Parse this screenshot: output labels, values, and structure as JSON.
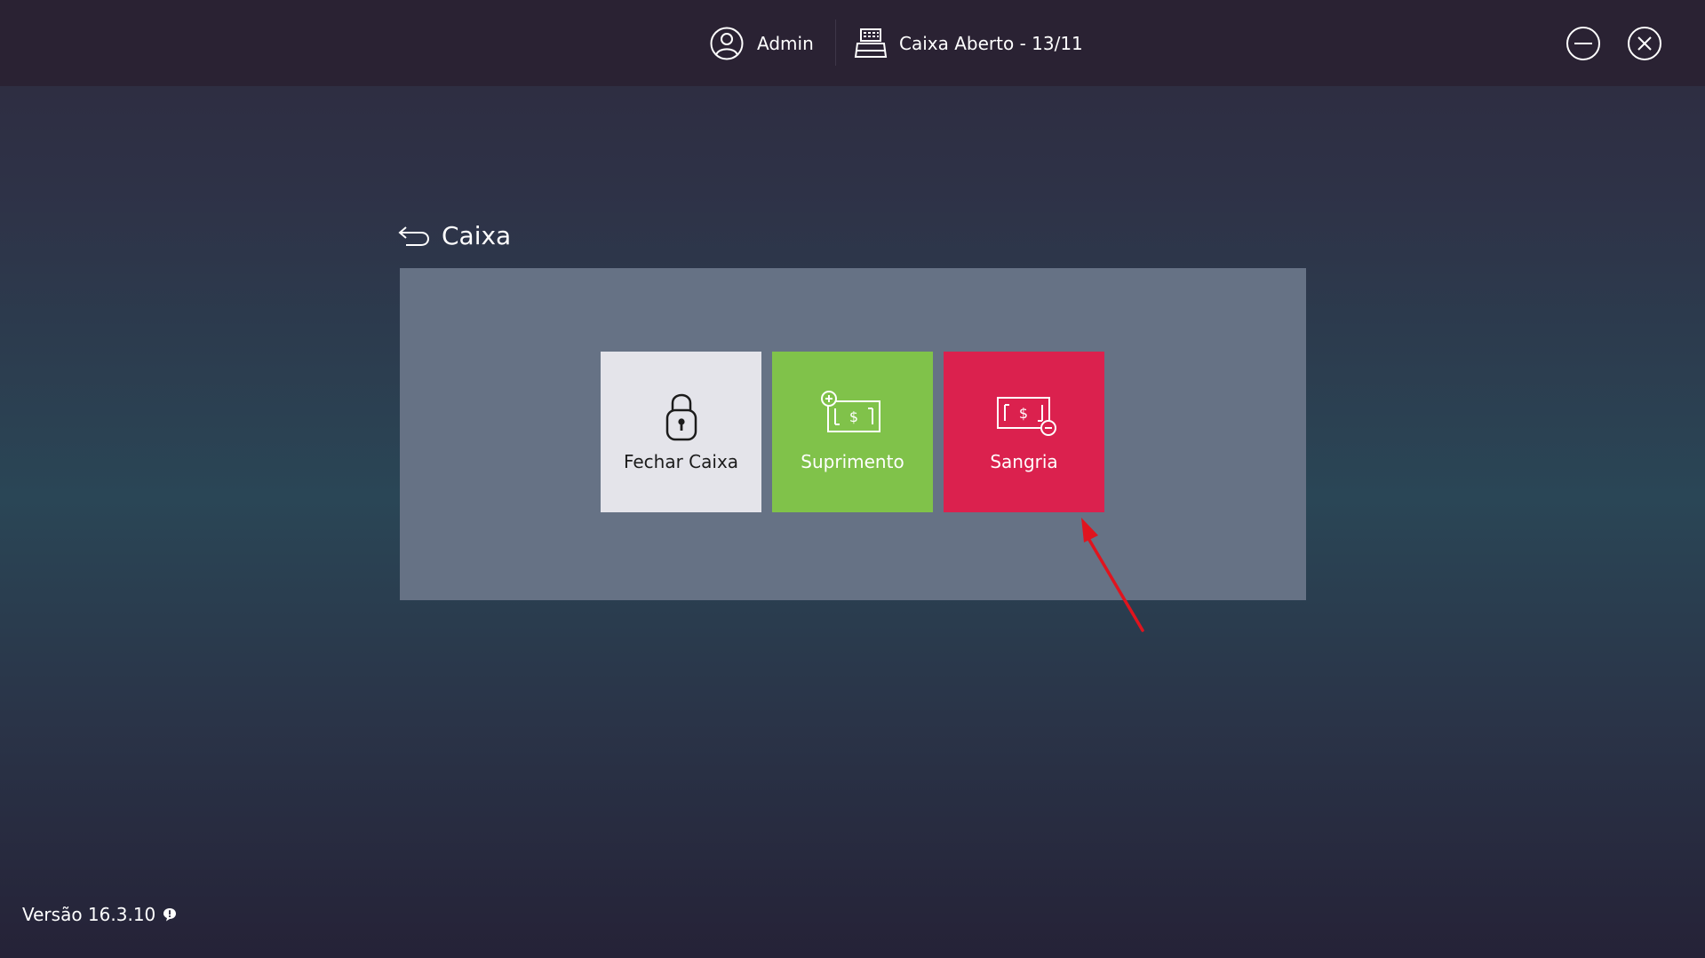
{
  "topbar": {
    "user": {
      "icon": "user-circle-icon",
      "name": "Admin"
    },
    "register": {
      "icon": "cash-register-icon",
      "status": "Caixa Aberto - 13/11"
    },
    "window_controls": [
      {
        "icon": "minimize-icon"
      },
      {
        "icon": "close-icon"
      }
    ]
  },
  "page": {
    "back_icon": "back-arrow-icon",
    "title": "Caixa"
  },
  "tiles": [
    {
      "label": "Fechar Caixa",
      "icon": "lock-icon",
      "color": "#e4e4ea"
    },
    {
      "label": "Suprimento",
      "icon": "cash-add-icon",
      "color": "#80c24a"
    },
    {
      "label": "Sangria",
      "icon": "cash-remove-icon",
      "color": "#db214e"
    }
  ],
  "annotation": {
    "type": "arrow",
    "color": "#e0141e",
    "target": "Sangria"
  },
  "footer": {
    "version": "Versão 16.3.10",
    "info_icon": "info-bubble-icon"
  }
}
